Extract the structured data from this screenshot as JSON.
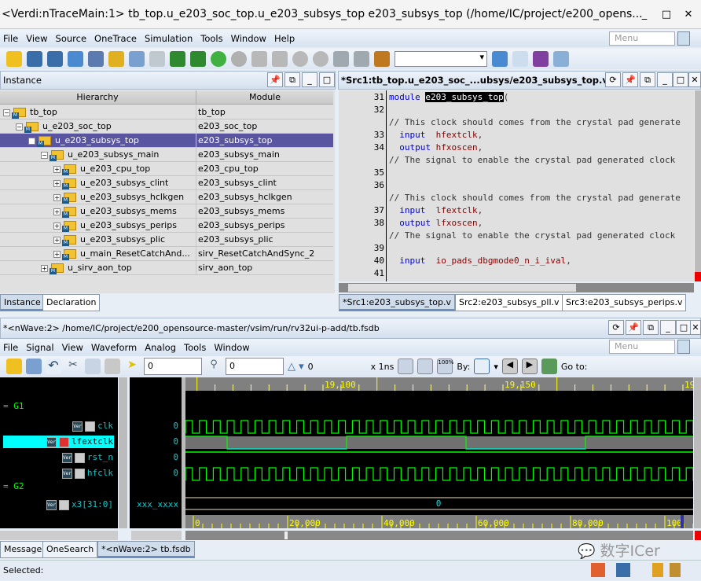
{
  "main_window": {
    "title": "<Verdi:nTraceMain:1> tb_top.u_e203_soc_top.u_e203_subsys_top e203_subsys_top (/home/IC/project/e200_opens...",
    "menu": [
      "File",
      "View",
      "Source",
      "OneTrace",
      "Simulation",
      "Tools",
      "Window",
      "Help"
    ],
    "menu_search_placeholder": "Menu"
  },
  "instance_panel": {
    "title": "Instance",
    "columns": [
      "Hierarchy",
      "Module"
    ],
    "rows": [
      {
        "name": "tb_top",
        "module": "tb_top",
        "level": 0,
        "expander": "-"
      },
      {
        "name": "u_e203_soc_top",
        "module": "e203_soc_top",
        "level": 1,
        "expander": "-"
      },
      {
        "name": "u_e203_subsys_top",
        "module": "e203_subsys_top",
        "level": 2,
        "expander": "-",
        "selected": true
      },
      {
        "name": "u_e203_subsys_main",
        "module": "e203_subsys_main",
        "level": 3,
        "expander": "-"
      },
      {
        "name": "u_e203_cpu_top",
        "module": "e203_cpu_top",
        "level": 4,
        "expander": "+"
      },
      {
        "name": "u_e203_subsys_clint",
        "module": "e203_subsys_clint",
        "level": 4,
        "expander": "+"
      },
      {
        "name": "u_e203_subsys_hclkgen",
        "module": "e203_subsys_hclkgen",
        "level": 4,
        "expander": "+"
      },
      {
        "name": "u_e203_subsys_mems",
        "module": "e203_subsys_mems",
        "level": 4,
        "expander": "+"
      },
      {
        "name": "u_e203_subsys_perips",
        "module": "e203_subsys_perips",
        "level": 4,
        "expander": "+"
      },
      {
        "name": "u_e203_subsys_plic",
        "module": "e203_subsys_plic",
        "level": 4,
        "expander": "+"
      },
      {
        "name": "u_main_ResetCatchAnd...",
        "module": "sirv_ResetCatchAndSync_2",
        "level": 4,
        "expander": "+"
      },
      {
        "name": "u_sirv_aon_top",
        "module": "sirv_aon_top",
        "level": 3,
        "expander": "+"
      }
    ],
    "tabs": [
      "Instance",
      "Declaration"
    ]
  },
  "source_panel": {
    "title": "*Src1:tb_top.u_e203_soc_...ubsys/e203_subsys_top.v)",
    "lines": [
      {
        "n": "31",
        "parts": [
          [
            "kw",
            "module "
          ],
          [
            "sel",
            "e203_subsys_top"
          ],
          [
            "cm",
            "("
          ]
        ]
      },
      {
        "n": "32",
        "parts": []
      },
      {
        "n": "",
        "parts": [
          [
            "cm",
            "// This clock should comes from the crystal pad generate"
          ]
        ]
      },
      {
        "n": "33",
        "parts": [
          [
            "kw",
            "  input  "
          ],
          [
            "id",
            "hfextclk"
          ],
          [
            "cm",
            ","
          ]
        ]
      },
      {
        "n": "34",
        "parts": [
          [
            "kw",
            "  output "
          ],
          [
            "id",
            "hfxoscen"
          ],
          [
            "cm",
            ","
          ]
        ]
      },
      {
        "n": "",
        "parts": [
          [
            "cm",
            "// The signal to enable the crystal pad generated clock"
          ]
        ]
      },
      {
        "n": "35",
        "parts": []
      },
      {
        "n": "36",
        "parts": []
      },
      {
        "n": "",
        "parts": [
          [
            "cm",
            "// This clock should comes from the crystal pad generate"
          ]
        ]
      },
      {
        "n": "37",
        "parts": [
          [
            "kw",
            "  input  "
          ],
          [
            "id",
            "lfextclk"
          ],
          [
            "cm",
            ","
          ]
        ]
      },
      {
        "n": "38",
        "parts": [
          [
            "kw",
            "  output "
          ],
          [
            "id",
            "lfxoscen"
          ],
          [
            "cm",
            ","
          ]
        ]
      },
      {
        "n": "",
        "parts": [
          [
            "cm",
            "// The signal to enable the crystal pad generated clock"
          ]
        ]
      },
      {
        "n": "39",
        "parts": []
      },
      {
        "n": "40",
        "parts": [
          [
            "kw",
            "  input  "
          ],
          [
            "id",
            "io_pads_dbgmode0_n_i_ival"
          ],
          [
            "cm",
            ","
          ]
        ]
      },
      {
        "n": "41",
        "parts": []
      }
    ],
    "tabs": [
      "*Src1:e203_subsys_top.v",
      "Src2:e203_subsys_pll.v",
      "Src3:e203_subsys_perips.v"
    ]
  },
  "wave_window": {
    "title": "*<nWave:2> /home/IC/project/e200_opensource-master/vsim/run/rv32ui-p-add/tb.fsdb",
    "menu": [
      "File",
      "Signal",
      "View",
      "Waveform",
      "Analog",
      "Tools",
      "Window"
    ],
    "menu_search_placeholder": "Menu",
    "cursor_time": "0",
    "marker_time": "0",
    "delta": "0",
    "time_unit": "x 1ns",
    "by_label": "By:",
    "goto_label": "Go to:",
    "groups": [
      {
        "name": "G1",
        "signals": [
          {
            "name": "clk",
            "value": "0"
          },
          {
            "name": "lfextclk",
            "value": "0",
            "selected": true
          },
          {
            "name": "rst_n",
            "value": "0"
          },
          {
            "name": "hfclk",
            "value": "0"
          }
        ]
      },
      {
        "name": "G2",
        "signals": [
          {
            "name": "x3[31:0]",
            "value": "xxx_xxxx",
            "bus_value": "0"
          }
        ]
      }
    ],
    "top_ruler": [
      "19,100",
      "19,150",
      "19,"
    ],
    "bottom_ruler": [
      "0",
      "20,000",
      "40,000",
      "60,000",
      "80,000",
      "100"
    ],
    "colors": {
      "clock": "#00ff00",
      "low": "#00e0e0",
      "bus": "#f0e0c0",
      "selected_row": "#00ffff",
      "ruler_major": "#ffff00"
    }
  },
  "bottom_tabs": [
    "Message",
    "OneSearch",
    "*<nWave:2> tb.fsdb"
  ],
  "watermark": "数字ICer",
  "status": "Selected:"
}
